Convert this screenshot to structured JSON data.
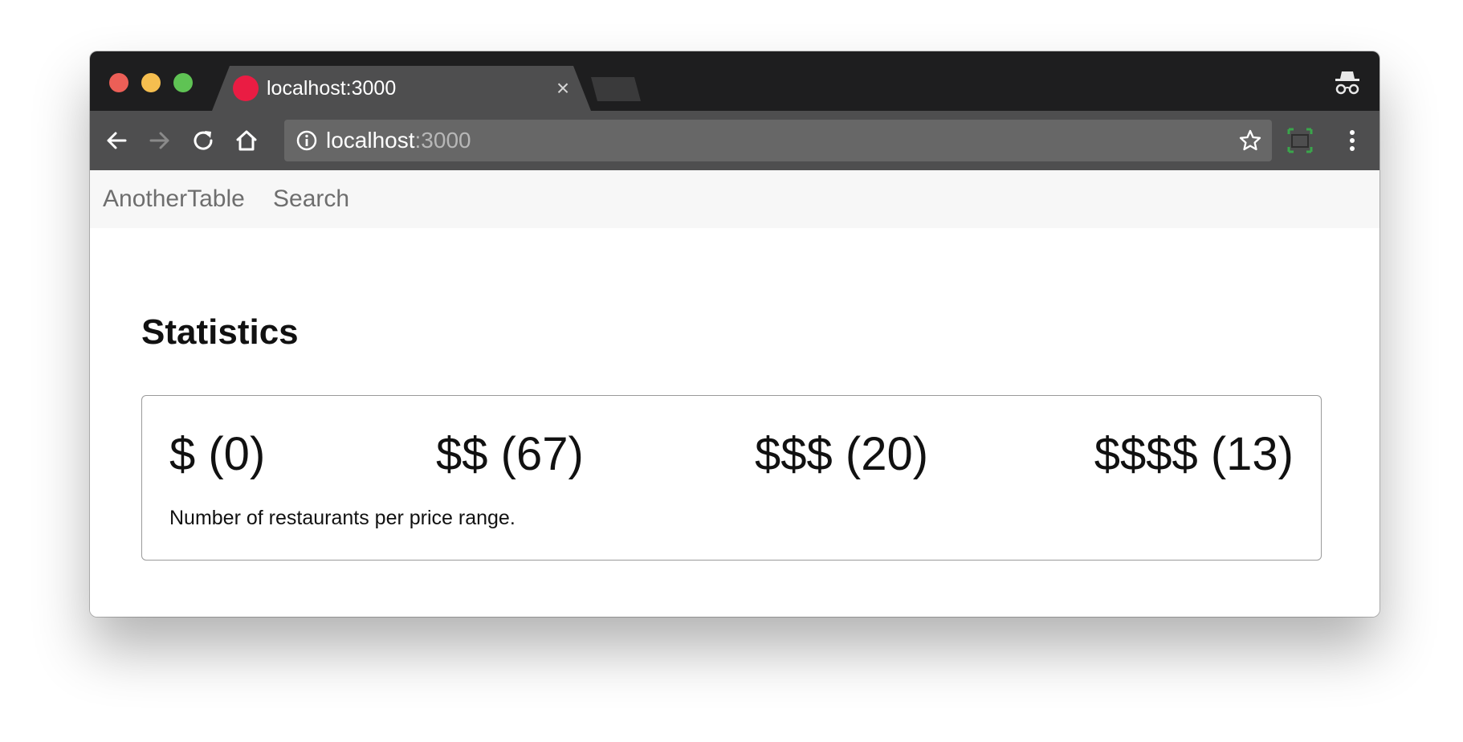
{
  "browser": {
    "tab": {
      "title": "localhost:3000",
      "close_symbol": "×",
      "favicon_color": "#ea1c43"
    },
    "address_bar": {
      "host": "localhost",
      "port": ":3000"
    },
    "icons": [
      "back-icon",
      "forward-icon",
      "reload-icon",
      "home-icon",
      "info-icon",
      "bookmark-star-icon",
      "cast-icon",
      "menu-icon",
      "incognito-icon"
    ]
  },
  "navbar": {
    "brand": "AnotherTable",
    "links": [
      {
        "label": "Search"
      }
    ]
  },
  "main": {
    "title": "Statistics",
    "stats": [
      {
        "label": "$ (0)",
        "range": "$",
        "count": 0
      },
      {
        "label": "$$ (67)",
        "range": "$$",
        "count": 67
      },
      {
        "label": "$$$ (20)",
        "range": "$$$",
        "count": 20
      },
      {
        "label": "$$$$ (13)",
        "range": "$$$$",
        "count": 13
      }
    ],
    "caption": "Number of restaurants per price range."
  }
}
